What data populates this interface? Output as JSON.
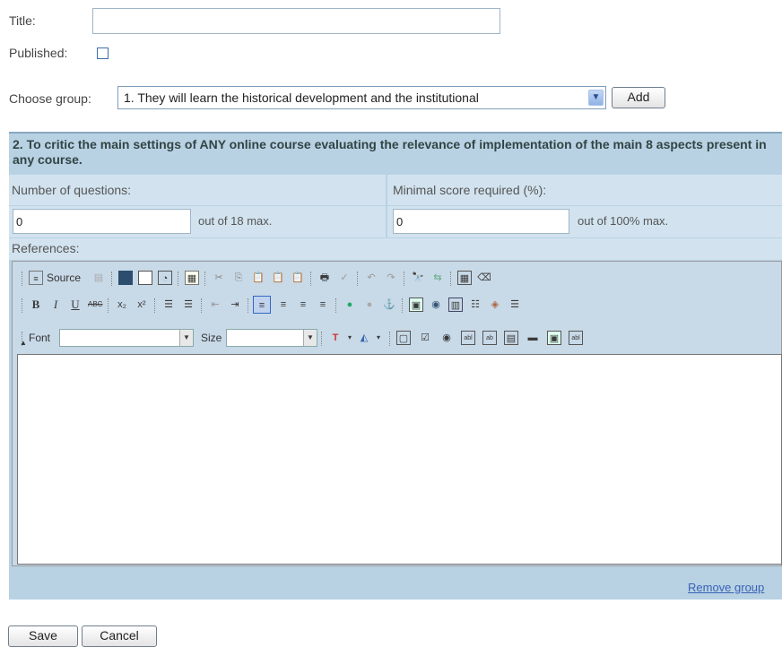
{
  "form": {
    "title_label": "Title:",
    "title_value": "",
    "published_label": "Published:",
    "published_checked": false,
    "choose_group_label": "Choose group:",
    "choose_group_selected": "1. They will learn the historical development and the institutional",
    "add_label": "Add"
  },
  "group": {
    "heading": "2. To critic the main settings of ANY online course evaluating the relevance of implementation of the main 8 aspects present in any course.",
    "num_questions_label": "Number of questions:",
    "num_questions_value": "0",
    "num_questions_max": "out of 18 max.",
    "min_score_label": "Minimal score required (%):",
    "min_score_value": "0",
    "min_score_max": "out of 100% max.",
    "references_label": "References:",
    "remove_group_label": "Remove group"
  },
  "editor": {
    "source_label": "Source",
    "font_label": "Font",
    "size_label": "Size",
    "font_value": "",
    "size_value": ""
  },
  "actions": {
    "save_label": "Save",
    "cancel_label": "Cancel"
  }
}
